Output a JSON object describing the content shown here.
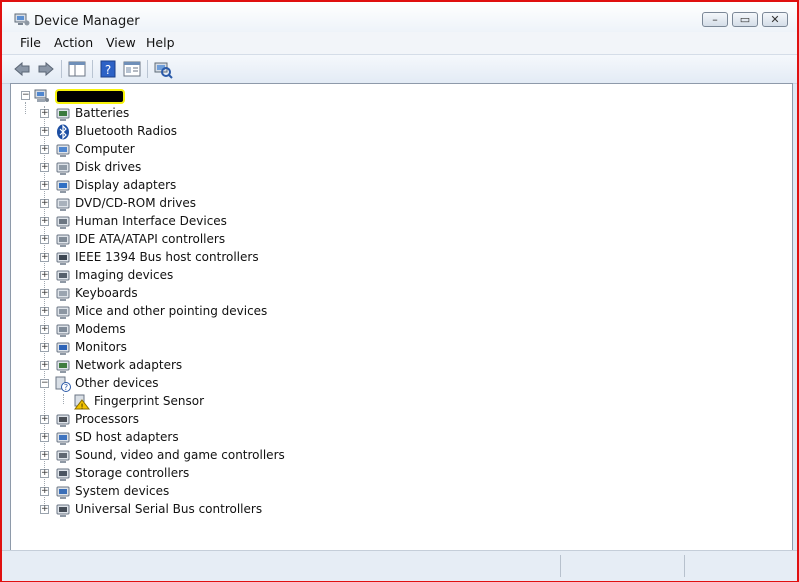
{
  "window": {
    "title": "Device Manager"
  },
  "menu": [
    "File",
    "Action",
    "View",
    "Help"
  ],
  "toolbar": {
    "buttons": [
      "back-icon",
      "forward-icon",
      "show-hide-console-tree-icon",
      "help-icon",
      "properties-icon",
      "scan-hardware-icon"
    ]
  },
  "tree": {
    "root_label": "",
    "categories": [
      {
        "label": "Batteries",
        "icon": "battery-icon"
      },
      {
        "label": "Bluetooth Radios",
        "icon": "bluetooth-icon"
      },
      {
        "label": "Computer",
        "icon": "computer-icon"
      },
      {
        "label": "Disk drives",
        "icon": "disk-drive-icon"
      },
      {
        "label": "Display adapters",
        "icon": "display-adapter-icon"
      },
      {
        "label": "DVD/CD-ROM drives",
        "icon": "dvd-drive-icon"
      },
      {
        "label": "Human Interface Devices",
        "icon": "hid-icon"
      },
      {
        "label": "IDE ATA/ATAPI controllers",
        "icon": "ide-controller-icon"
      },
      {
        "label": "IEEE 1394 Bus host controllers",
        "icon": "firewire-icon"
      },
      {
        "label": "Imaging devices",
        "icon": "camera-icon"
      },
      {
        "label": "Keyboards",
        "icon": "keyboard-icon"
      },
      {
        "label": "Mice and other pointing devices",
        "icon": "mouse-icon"
      },
      {
        "label": "Modems",
        "icon": "modem-icon"
      },
      {
        "label": "Monitors",
        "icon": "monitor-icon"
      },
      {
        "label": "Network adapters",
        "icon": "network-adapter-icon"
      },
      {
        "label": "Other devices",
        "icon": "unknown-device-icon",
        "expanded": true
      },
      {
        "label": "Fingerprint Sensor",
        "icon": "warning-device-icon",
        "child": true
      },
      {
        "label": "Processors",
        "icon": "processor-icon"
      },
      {
        "label": "SD host adapters",
        "icon": "sd-card-icon"
      },
      {
        "label": "Sound, video and game controllers",
        "icon": "speaker-icon"
      },
      {
        "label": "Storage controllers",
        "icon": "storage-controller-icon"
      },
      {
        "label": "System devices",
        "icon": "system-device-icon"
      },
      {
        "label": "Universal Serial Bus controllers",
        "icon": "usb-icon"
      }
    ]
  },
  "colors": {
    "frame_highlight": "#e01010",
    "redaction": "#000000",
    "marker": "#f6f20a"
  }
}
